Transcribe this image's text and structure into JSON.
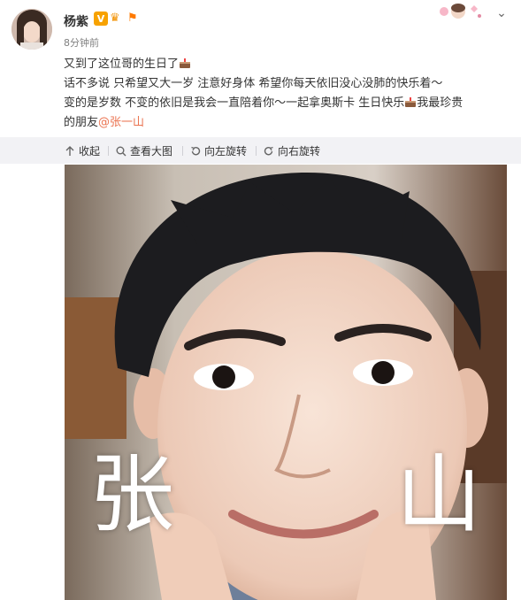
{
  "user": {
    "name": "杨紫",
    "time": "8分钟前"
  },
  "post": {
    "line1": "又到了这位哥的生日了",
    "line2": "话不多说 只希望又大一岁 注意好身体 希望你每天依旧没心没肺的快乐着～",
    "line3a": "变的是岁数 不变的依旧是我会一直陪着你～一起拿奥斯卡 生日快乐",
    "line3b": "我最珍贵",
    "line4a": "的朋友",
    "mention": "@张一山"
  },
  "toolbar": {
    "collapse": "收起",
    "view_large": "查看大图",
    "rotate_left": "向左旋转",
    "rotate_right": "向右旋转"
  },
  "photo": {
    "char_left": "张",
    "char_right": "山"
  },
  "icons": {
    "verified": "verified-v-icon",
    "crown": "crown-icon",
    "flag": "flag-icon",
    "cake": "cake-emoji-icon",
    "more": "chevron-down-icon"
  },
  "colors": {
    "mention": "#eb7350",
    "toolbar_bg": "#f2f2f5",
    "badge": "#f7a200"
  }
}
